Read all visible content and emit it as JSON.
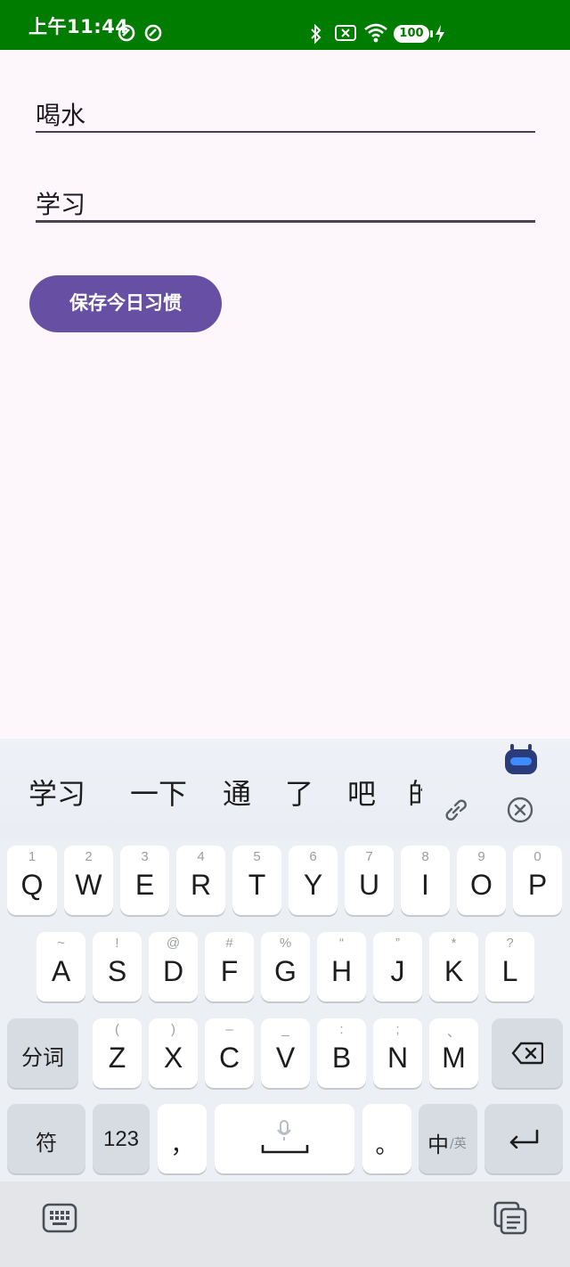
{
  "status_bar": {
    "time": "上午11:44",
    "battery": "100"
  },
  "form": {
    "field1_value": "喝水",
    "field2_value": "学习",
    "save_label": "保存今日习惯"
  },
  "keyboard": {
    "candidates": [
      "学习",
      "一下",
      "通",
      "了",
      "吧",
      "的"
    ],
    "row1": [
      {
        "main": "Q",
        "sub": "1"
      },
      {
        "main": "W",
        "sub": "2"
      },
      {
        "main": "E",
        "sub": "3"
      },
      {
        "main": "R",
        "sub": "4"
      },
      {
        "main": "T",
        "sub": "5"
      },
      {
        "main": "Y",
        "sub": "6"
      },
      {
        "main": "U",
        "sub": "7"
      },
      {
        "main": "I",
        "sub": "8"
      },
      {
        "main": "O",
        "sub": "9"
      },
      {
        "main": "P",
        "sub": "0"
      }
    ],
    "row2": [
      {
        "main": "A",
        "sub": "~"
      },
      {
        "main": "S",
        "sub": "!"
      },
      {
        "main": "D",
        "sub": "@"
      },
      {
        "main": "F",
        "sub": "#"
      },
      {
        "main": "G",
        "sub": "%"
      },
      {
        "main": "H",
        "sub": "“"
      },
      {
        "main": "J",
        "sub": "”"
      },
      {
        "main": "K",
        "sub": "*"
      },
      {
        "main": "L",
        "sub": "?"
      }
    ],
    "row3": [
      {
        "main": "Z",
        "sub": "("
      },
      {
        "main": "X",
        "sub": ")"
      },
      {
        "main": "C",
        "sub": "–"
      },
      {
        "main": "V",
        "sub": "_"
      },
      {
        "main": "B",
        "sub": ":"
      },
      {
        "main": "N",
        "sub": ";"
      },
      {
        "main": "M",
        "sub": "、"
      }
    ],
    "fenci_label": "分词",
    "symbols_label": "符",
    "numbers_label": "123",
    "comma_label": "，",
    "period_label": "。",
    "lang_main": "中",
    "lang_sub": "/英"
  }
}
